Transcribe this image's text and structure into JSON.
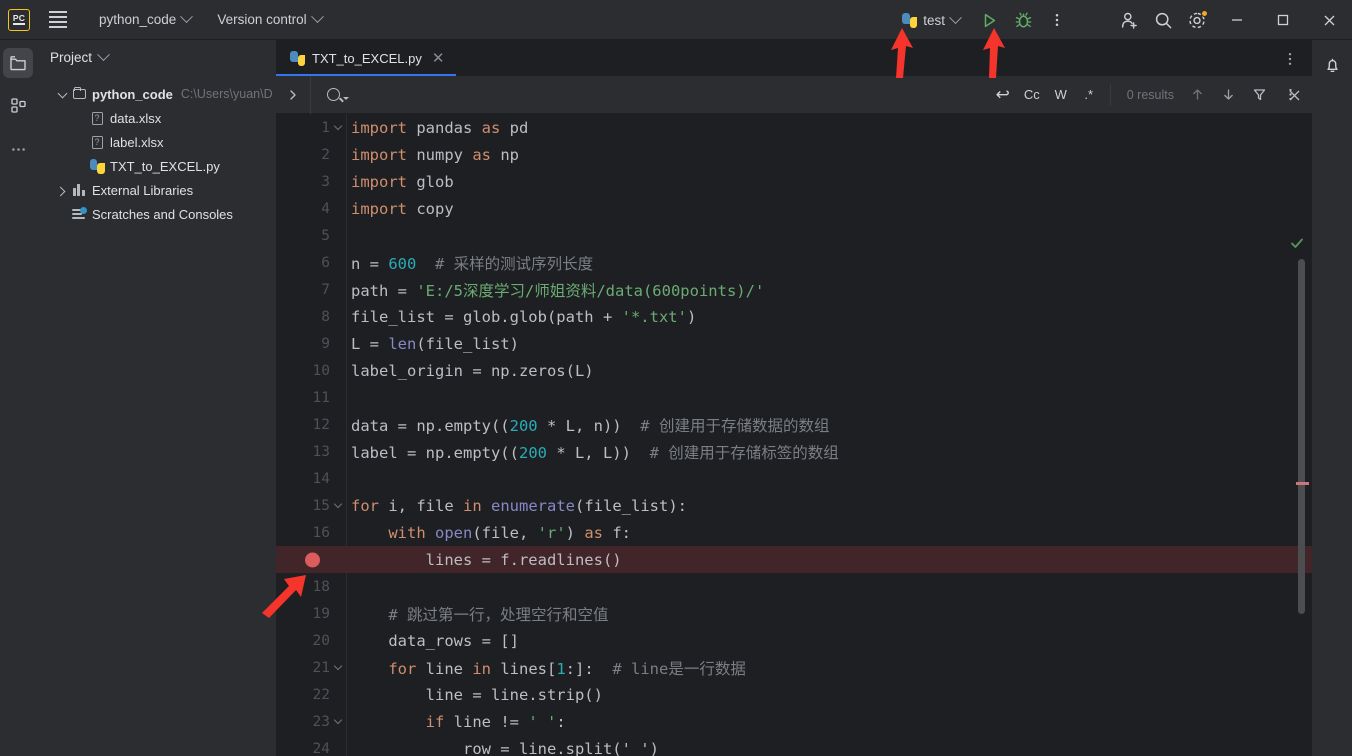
{
  "titlebar": {
    "logo_text": "PC",
    "menu_icon": "hamburger-menu-icon",
    "project_name": "python_code",
    "vcs_label": "Version control",
    "run_config": "test",
    "run_icon": "run-triangle-icon",
    "debug_icon": "debug-bug-icon",
    "more_icon": "more-vertical-icon",
    "account_icon": "account-add-icon",
    "search_icon": "search-icon",
    "settings_icon": "gear-icon",
    "minimize": "–",
    "maximize": "□",
    "close": "✕"
  },
  "activitybar": {
    "items": [
      {
        "name": "project-folder-icon",
        "active": true
      },
      {
        "name": "structure-icon",
        "active": false
      },
      {
        "name": "more-dots-icon",
        "active": false
      }
    ]
  },
  "project_panel": {
    "title": "Project",
    "tree": [
      {
        "label": "python_code",
        "path": "C:\\Users\\yuan\\D",
        "icon": "folder-icon",
        "indent": 0,
        "twisty": "down",
        "bold": true
      },
      {
        "label": "data.xlsx",
        "path": "",
        "icon": "unknown-file-icon",
        "indent": 1,
        "twisty": "none",
        "bold": false
      },
      {
        "label": "label.xlsx",
        "path": "",
        "icon": "unknown-file-icon",
        "indent": 1,
        "twisty": "none",
        "bold": false
      },
      {
        "label": "TXT_to_EXCEL.py",
        "path": "",
        "icon": "python-file-icon",
        "indent": 1,
        "twisty": "none",
        "bold": false
      },
      {
        "label": "External Libraries",
        "path": "",
        "icon": "library-icon",
        "indent": 0,
        "twisty": "right",
        "bold": false
      },
      {
        "label": "Scratches and Consoles",
        "path": "",
        "icon": "scratch-icon",
        "indent": 0,
        "twisty": "none",
        "bold": false
      }
    ]
  },
  "editor": {
    "tab": {
      "label": "TXT_to_EXCEL.py",
      "icon": "python-file-icon",
      "close": "✕"
    },
    "tabbar_more": "more-vertical-icon",
    "findbar": {
      "expand_icon": "chevron-right-icon",
      "search_value": "",
      "search_placeholder": "",
      "toggle_regex_loop": "↩",
      "toggle_case": "Cc",
      "toggle_words": "W",
      "toggle_regex": ".*",
      "results_text": "0 results",
      "prev_icon": "arrow-up-icon",
      "next_icon": "arrow-down-icon",
      "filter_icon": "filter-icon",
      "more_icon": "more-vertical-icon",
      "close_icon": "close-icon"
    },
    "inspection_status": "check-ok-icon",
    "lines": [
      {
        "num": "1",
        "fold": true,
        "bp": false,
        "tokens": [
          {
            "t": "import",
            "c": "k"
          },
          {
            "t": " pandas ",
            "c": "id"
          },
          {
            "t": "as",
            "c": "k"
          },
          {
            "t": " pd",
            "c": "id"
          }
        ]
      },
      {
        "num": "2",
        "fold": false,
        "bp": false,
        "tokens": [
          {
            "t": "import",
            "c": "k"
          },
          {
            "t": " numpy ",
            "c": "id"
          },
          {
            "t": "as",
            "c": "k"
          },
          {
            "t": " np",
            "c": "id"
          }
        ]
      },
      {
        "num": "3",
        "fold": false,
        "bp": false,
        "tokens": [
          {
            "t": "import",
            "c": "k"
          },
          {
            "t": " glob",
            "c": "id"
          }
        ]
      },
      {
        "num": "4",
        "fold": false,
        "bp": false,
        "tokens": [
          {
            "t": "import",
            "c": "k"
          },
          {
            "t": " copy",
            "c": "id"
          }
        ]
      },
      {
        "num": "5",
        "fold": false,
        "bp": false,
        "tokens": []
      },
      {
        "num": "6",
        "fold": false,
        "bp": false,
        "tokens": [
          {
            "t": "n = ",
            "c": "id"
          },
          {
            "t": "600",
            "c": "n"
          },
          {
            "t": "  # 采样的测试序列长度",
            "c": "c"
          }
        ]
      },
      {
        "num": "7",
        "fold": false,
        "bp": false,
        "tokens": [
          {
            "t": "path = ",
            "c": "id"
          },
          {
            "t": "'E:/5深度学习/师姐资料/data(600points)/'",
            "c": "s"
          }
        ]
      },
      {
        "num": "8",
        "fold": false,
        "bp": false,
        "tokens": [
          {
            "t": "file_list = glob.glob(path + ",
            "c": "id"
          },
          {
            "t": "'*.txt'",
            "c": "s"
          },
          {
            "t": ")",
            "c": "id"
          }
        ]
      },
      {
        "num": "9",
        "fold": false,
        "bp": false,
        "tokens": [
          {
            "t": "L = ",
            "c": "id"
          },
          {
            "t": "len",
            "c": "b"
          },
          {
            "t": "(file_list)",
            "c": "id"
          }
        ]
      },
      {
        "num": "10",
        "fold": false,
        "bp": false,
        "tokens": [
          {
            "t": "label_origin = np.zeros(L)",
            "c": "id"
          }
        ]
      },
      {
        "num": "11",
        "fold": false,
        "bp": false,
        "tokens": []
      },
      {
        "num": "12",
        "fold": false,
        "bp": false,
        "tokens": [
          {
            "t": "data = np.empty((",
            "c": "id"
          },
          {
            "t": "200",
            "c": "n"
          },
          {
            "t": " * L, n))",
            "c": "id"
          },
          {
            "t": "  # 创建用于存储数据的数组",
            "c": "c"
          }
        ]
      },
      {
        "num": "13",
        "fold": false,
        "bp": false,
        "tokens": [
          {
            "t": "label = np.empty((",
            "c": "id"
          },
          {
            "t": "200",
            "c": "n"
          },
          {
            "t": " * L, L))",
            "c": "id"
          },
          {
            "t": "  # 创建用于存储标签的数组",
            "c": "c"
          }
        ]
      },
      {
        "num": "14",
        "fold": false,
        "bp": false,
        "tokens": []
      },
      {
        "num": "15",
        "fold": true,
        "bp": false,
        "tokens": [
          {
            "t": "for",
            "c": "k"
          },
          {
            "t": " i, file ",
            "c": "id"
          },
          {
            "t": "in",
            "c": "k"
          },
          {
            "t": " ",
            "c": "id"
          },
          {
            "t": "enumerate",
            "c": "b"
          },
          {
            "t": "(file_list):",
            "c": "id"
          }
        ]
      },
      {
        "num": "16",
        "fold": false,
        "bp": false,
        "tokens": [
          {
            "t": "    ",
            "c": "id"
          },
          {
            "t": "with",
            "c": "k"
          },
          {
            "t": " ",
            "c": "id"
          },
          {
            "t": "open",
            "c": "b"
          },
          {
            "t": "(file, ",
            "c": "id"
          },
          {
            "t": "'r'",
            "c": "s"
          },
          {
            "t": ") ",
            "c": "id"
          },
          {
            "t": "as",
            "c": "k"
          },
          {
            "t": " f:",
            "c": "id"
          }
        ]
      },
      {
        "num": "17",
        "fold": false,
        "bp": true,
        "tokens": [
          {
            "t": "        lines = f.readlines()",
            "c": "id"
          }
        ]
      },
      {
        "num": "18",
        "fold": false,
        "bp": false,
        "tokens": []
      },
      {
        "num": "19",
        "fold": false,
        "bp": false,
        "tokens": [
          {
            "t": "    # 跳过第一行，处理空行和空值",
            "c": "c"
          }
        ]
      },
      {
        "num": "20",
        "fold": false,
        "bp": false,
        "tokens": [
          {
            "t": "    data_rows = []",
            "c": "id"
          }
        ]
      },
      {
        "num": "21",
        "fold": true,
        "bp": false,
        "tokens": [
          {
            "t": "    ",
            "c": "id"
          },
          {
            "t": "for",
            "c": "k"
          },
          {
            "t": " line ",
            "c": "id"
          },
          {
            "t": "in",
            "c": "k"
          },
          {
            "t": " lines[",
            "c": "id"
          },
          {
            "t": "1",
            "c": "n"
          },
          {
            "t": ":]:",
            "c": "id"
          },
          {
            "t": "  # line是一行数据",
            "c": "c"
          }
        ]
      },
      {
        "num": "22",
        "fold": false,
        "bp": false,
        "tokens": [
          {
            "t": "        line = line.strip()",
            "c": "id"
          }
        ]
      },
      {
        "num": "23",
        "fold": true,
        "bp": false,
        "tokens": [
          {
            "t": "        ",
            "c": "id"
          },
          {
            "t": "if",
            "c": "k"
          },
          {
            "t": " line != ",
            "c": "id"
          },
          {
            "t": "' '",
            "c": "s"
          },
          {
            "t": ":",
            "c": "id"
          }
        ]
      },
      {
        "num": "24",
        "fold": false,
        "bp": false,
        "tokens": [
          {
            "t": "            row = line.split(' ')",
            "c": "id"
          }
        ]
      }
    ]
  },
  "rightbar": {
    "notifications_icon": "bell-icon"
  },
  "annotations": {
    "arrow_color": "#f5342b",
    "arrows": [
      {
        "name": "arrow-pointing-run-button"
      },
      {
        "name": "arrow-pointing-debug-button"
      },
      {
        "name": "arrow-pointing-breakpoint"
      }
    ]
  },
  "colors": {
    "editor_bg": "#1e1f22",
    "panel_bg": "#2b2d30",
    "accent": "#3574f0",
    "breakpoint": "#db5c5c",
    "breakpoint_line_bg": "#412529",
    "keyword": "#cf8e6d",
    "string": "#6aab73",
    "number": "#2aacb8",
    "comment": "#7a7e85",
    "builtin": "#8888c6"
  }
}
